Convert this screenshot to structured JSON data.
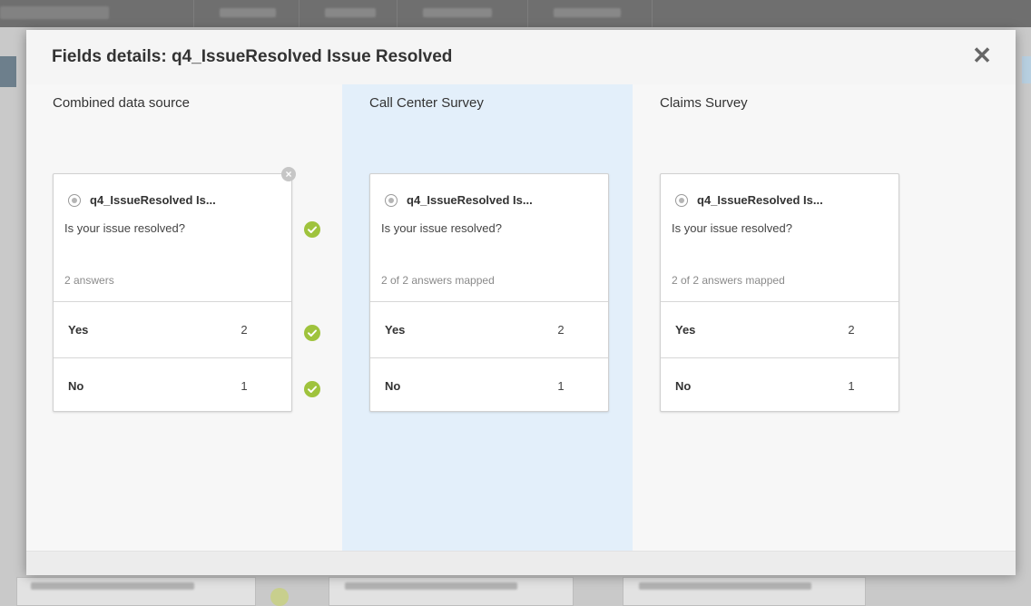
{
  "modal": {
    "title": "Fields details: q4_IssueResolved Issue Resolved",
    "close_glyph": "✕"
  },
  "columns": [
    {
      "heading": "Combined data source",
      "field_name": "q4_IssueResolved Is...",
      "question": "Is your issue resolved?",
      "answer_count": "2 answers",
      "answers": [
        {
          "label": "Yes",
          "value": "2"
        },
        {
          "label": "No",
          "value": "1"
        }
      ]
    },
    {
      "heading": "Call Center Survey",
      "field_name": "q4_IssueResolved Is...",
      "question": "Is your issue resolved?",
      "answer_count": "2 of 2 answers mapped",
      "answers": [
        {
          "label": "Yes",
          "value": "2"
        },
        {
          "label": "No",
          "value": "1"
        }
      ]
    },
    {
      "heading": "Claims Survey",
      "field_name": "q4_IssueResolved Is...",
      "question": "Is your issue resolved?",
      "answer_count": "2 of 2 answers mapped",
      "answers": [
        {
          "label": "Yes",
          "value": "2"
        },
        {
          "label": "No",
          "value": "1"
        }
      ]
    }
  ],
  "icons": {
    "remove": "remove-icon",
    "check": "check-circle-icon",
    "radio": "radio-icon",
    "close": "close-icon"
  },
  "colors": {
    "highlight_column": "#e3effa",
    "check_green": "#9fc33d",
    "overlay": "#c9c9c9"
  }
}
